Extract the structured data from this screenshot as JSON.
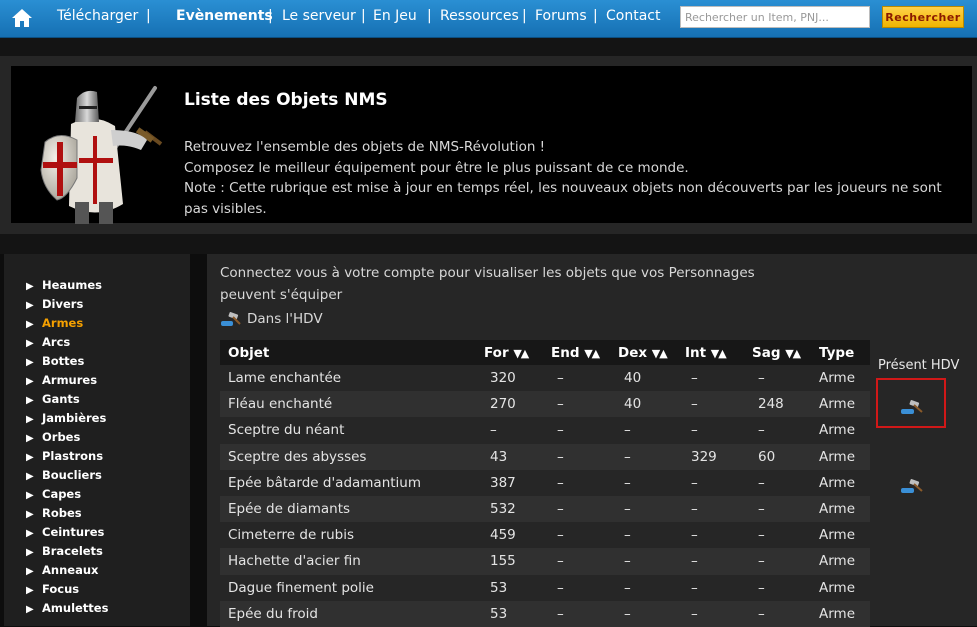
{
  "nav": {
    "items": [
      "Télécharger",
      "Evènements",
      "Le serveur",
      "En Jeu",
      "Ressources",
      "Forums",
      "Contact"
    ],
    "separator": "|",
    "search_placeholder": "Rechercher un Item, PNJ...",
    "search_button": "Rechercher"
  },
  "header": {
    "title": "Liste des Objets NMS",
    "lines": [
      "Retrouvez l'ensemble des objets de NMS-Révolution !",
      "Composez le meilleur équipement pour être le plus puissant de ce monde.",
      "Note : Cette rubrique est mise à jour en temps réel, les nouveaux objets non découverts par les joueurs ne sont pas visibles."
    ]
  },
  "sidebar": {
    "active_index": 2,
    "items": [
      "Heaumes",
      "Divers",
      "Armes",
      "Arcs",
      "Bottes",
      "Armures",
      "Gants",
      "Jambières",
      "Orbes",
      "Plastrons",
      "Boucliers",
      "Capes",
      "Robes",
      "Ceintures",
      "Bracelets",
      "Anneaux",
      "Focus",
      "Amulettes"
    ]
  },
  "main": {
    "notice": "Connectez vous à votre compte pour visualiser les objets que vos Personnages peuvent s'équiper",
    "hdv_legend": "Dans l'HDV",
    "present_hdv_label": "Présent HDV"
  },
  "table": {
    "columns": [
      "Objet",
      "For",
      "End",
      "Dex",
      "Int",
      "Sag",
      "Type"
    ],
    "sort_glyph": "▼▲",
    "rows": [
      {
        "objet": "Lame enchantée",
        "for": "320",
        "end": "–",
        "dex": "40",
        "int": "–",
        "sag": "–",
        "type": "Arme",
        "hdv": false
      },
      {
        "objet": "Fléau enchanté",
        "for": "270",
        "end": "–",
        "dex": "40",
        "int": "–",
        "sag": "248",
        "type": "Arme",
        "hdv": true
      },
      {
        "objet": "Sceptre du néant",
        "for": "–",
        "end": "–",
        "dex": "–",
        "int": "–",
        "sag": "–",
        "type": "Arme",
        "hdv": false
      },
      {
        "objet": "Sceptre des abysses",
        "for": "43",
        "end": "–",
        "dex": "–",
        "int": "329",
        "sag": "60",
        "type": "Arme",
        "hdv": false
      },
      {
        "objet": "Epée bâtarde d'adamantium",
        "for": "387",
        "end": "–",
        "dex": "–",
        "int": "–",
        "sag": "–",
        "type": "Arme",
        "hdv": true
      },
      {
        "objet": "Epée de diamants",
        "for": "532",
        "end": "–",
        "dex": "–",
        "int": "–",
        "sag": "–",
        "type": "Arme",
        "hdv": false
      },
      {
        "objet": "Cimeterre de rubis",
        "for": "459",
        "end": "–",
        "dex": "–",
        "int": "–",
        "sag": "–",
        "type": "Arme",
        "hdv": false
      },
      {
        "objet": "Hachette d'acier fin",
        "for": "155",
        "end": "–",
        "dex": "–",
        "int": "–",
        "sag": "–",
        "type": "Arme",
        "hdv": false
      },
      {
        "objet": "Dague finement polie",
        "for": "53",
        "end": "–",
        "dex": "–",
        "int": "–",
        "sag": "–",
        "type": "Arme",
        "hdv": false
      },
      {
        "objet": "Epée du froid",
        "for": "53",
        "end": "–",
        "dex": "–",
        "int": "–",
        "sag": "–",
        "type": "Arme",
        "hdv": false
      }
    ]
  },
  "colors": {
    "nav_bar": "#1f7fc4",
    "active_sidebar": "#f5a000",
    "search_button": "#f0b400",
    "highlight_box": "#d01818"
  },
  "icons": {
    "home": "home-icon",
    "bullet": "triangle-right-icon",
    "hdv": "gavel-icon"
  }
}
